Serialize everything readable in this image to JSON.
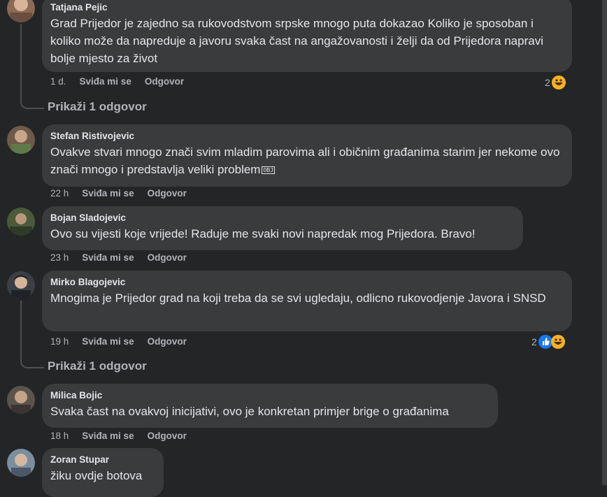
{
  "comments": [
    {
      "author": "Tatjana Pejic",
      "text": "Grad Prijedor je zajedno sa rukovodstvom srpske mnogo puta dokazao Koliko je sposoban i koliko može da napreduje a javoru svaka čast na angažovanosti i želji da od Prijedora napravi bolje mjesto za život",
      "time": "1 d.",
      "like": "Sviđa mi se",
      "reply": "Odgovor",
      "reaction_count": "2"
    },
    {
      "author": "Stefan Ristivojevic",
      "text": "Ovakve stvari mnogo znači svim mladim parovima ali i običnim građanima starim jer nekome ovo znači mnogo i predstavlja veliki problem",
      "emoji": "OBJ",
      "time": "22 h",
      "like": "Sviđa mi se",
      "reply": "Odgovor"
    },
    {
      "author": "Bojan Sladojevic",
      "text": "Ovo su vijesti koje vrijede! Raduje me svaki novi napredak mog Prijedora. Bravo!",
      "time": "23 h",
      "like": "Sviđa mi se",
      "reply": "Odgovor"
    },
    {
      "author": "Mirko Blagojevic",
      "text": "Mnogima je Prijedor grad na koji treba da se svi ugledaju, odlicno rukovodjenje Javora i SNSD",
      "time": "19 h",
      "like": "Sviđa mi se",
      "reply": "Odgovor",
      "reaction_count": "2"
    },
    {
      "author": "Milica Bojic",
      "text": "Svaka čast na ovakvoj inicijativi, ovo je konkretan primjer brige o građanima",
      "time": "18 h",
      "like": "Sviđa mi se",
      "reply": "Odgovor"
    },
    {
      "author": "Zoran Stupar",
      "text": "žiku ovdje botova"
    }
  ],
  "show_replies": [
    "Prikaži 1 odgovor",
    "Prikaži 1 odgovor"
  ],
  "icons": {
    "reaction_haha": "haha-emoji-icon",
    "reaction_like": "like-icon"
  },
  "colors": {
    "bg": "#242526",
    "bubble": "#3a3b3c",
    "text": "#e4e6eb",
    "muted": "#b0b3b8",
    "like": "#1877f2",
    "haha": "#f7b125"
  }
}
